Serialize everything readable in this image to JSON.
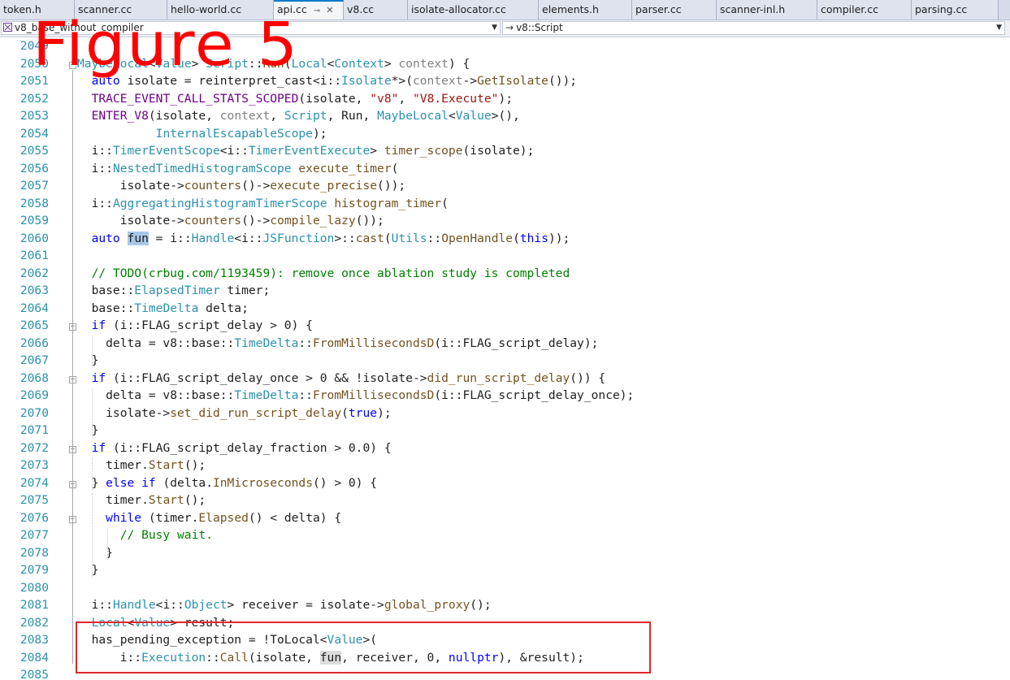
{
  "tabs": [
    {
      "label": "token.h",
      "active": false,
      "pinned": false
    },
    {
      "label": "scanner.cc",
      "active": false,
      "pinned": false
    },
    {
      "label": "hello-world.cc",
      "active": false,
      "pinned": false
    },
    {
      "label": "api.cc",
      "active": true,
      "pinned": true
    },
    {
      "label": "v8.cc",
      "active": false,
      "pinned": false
    },
    {
      "label": "isolate-allocator.cc",
      "active": false,
      "pinned": false
    },
    {
      "label": "elements.h",
      "active": false,
      "pinned": false
    },
    {
      "label": "parser.cc",
      "active": false,
      "pinned": false
    },
    {
      "label": "scanner-inl.h",
      "active": false,
      "pinned": false
    },
    {
      "label": "compiler.cc",
      "active": false,
      "pinned": false
    },
    {
      "label": "parsing.cc",
      "active": false,
      "pinned": false
    }
  ],
  "nav": {
    "project": "v8_base_without_compiler",
    "scope": "v8::Script"
  },
  "overlay": {
    "figure_label": "Figure 5",
    "highlight_color": "#e0262b"
  },
  "colors": {
    "keyword": "#0000ff",
    "type": "#2b91af",
    "function": "#74531f",
    "string": "#a31515",
    "macro": "#6f008a",
    "comment": "#008000",
    "line_number": "#2b91af",
    "accent": "#007acc"
  },
  "editor": {
    "lines": [
      {
        "n": "2049",
        "code": ""
      },
      {
        "n": "2050",
        "code": "MaybeLocal<Value> Script::Run(Local<Context> context) {"
      },
      {
        "n": "2051",
        "code": "  auto isolate = reinterpret_cast<i::Isolate*>(context->GetIsolate());"
      },
      {
        "n": "2052",
        "code": "  TRACE_EVENT_CALL_STATS_SCOPED(isolate, \"v8\", \"V8.Execute\");"
      },
      {
        "n": "2053",
        "code": "  ENTER_V8(isolate, context, Script, Run, MaybeLocal<Value>(),"
      },
      {
        "n": "2054",
        "code": "           InternalEscapableScope);"
      },
      {
        "n": "2055",
        "code": "  i::TimerEventScope<i::TimerEventExecute> timer_scope(isolate);"
      },
      {
        "n": "2056",
        "code": "  i::NestedTimedHistogramScope execute_timer("
      },
      {
        "n": "2057",
        "code": "      isolate->counters()->execute_precise());"
      },
      {
        "n": "2058",
        "code": "  i::AggregatingHistogramTimerScope histogram_timer("
      },
      {
        "n": "2059",
        "code": "      isolate->counters()->compile_lazy());"
      },
      {
        "n": "2060",
        "code": "  auto fun = i::Handle<i::JSFunction>::cast(Utils::OpenHandle(this));"
      },
      {
        "n": "2061",
        "code": ""
      },
      {
        "n": "2062",
        "code": "  // TODO(crbug.com/1193459): remove once ablation study is completed"
      },
      {
        "n": "2063",
        "code": "  base::ElapsedTimer timer;"
      },
      {
        "n": "2064",
        "code": "  base::TimeDelta delta;"
      },
      {
        "n": "2065",
        "code": "  if (i::FLAG_script_delay > 0) {"
      },
      {
        "n": "2066",
        "code": "    delta = v8::base::TimeDelta::FromMillisecondsD(i::FLAG_script_delay);"
      },
      {
        "n": "2067",
        "code": "  }"
      },
      {
        "n": "2068",
        "code": "  if (i::FLAG_script_delay_once > 0 && !isolate->did_run_script_delay()) {"
      },
      {
        "n": "2069",
        "code": "    delta = v8::base::TimeDelta::FromMillisecondsD(i::FLAG_script_delay_once);"
      },
      {
        "n": "2070",
        "code": "    isolate->set_did_run_script_delay(true);"
      },
      {
        "n": "2071",
        "code": "  }"
      },
      {
        "n": "2072",
        "code": "  if (i::FLAG_script_delay_fraction > 0.0) {"
      },
      {
        "n": "2073",
        "code": "    timer.Start();"
      },
      {
        "n": "2074",
        "code": "  } else if (delta.InMicroseconds() > 0) {"
      },
      {
        "n": "2075",
        "code": "    timer.Start();"
      },
      {
        "n": "2076",
        "code": "    while (timer.Elapsed() < delta) {"
      },
      {
        "n": "2077",
        "code": "      // Busy wait."
      },
      {
        "n": "2078",
        "code": "    }"
      },
      {
        "n": "2079",
        "code": "  }"
      },
      {
        "n": "2080",
        "code": ""
      },
      {
        "n": "2081",
        "code": "  i::Handle<i::Object> receiver = isolate->global_proxy();"
      },
      {
        "n": "2082",
        "code": "  Local<Value> result;"
      },
      {
        "n": "2083",
        "code": "  has_pending_exception = !ToLocal<Value>("
      },
      {
        "n": "2084",
        "code": "      i::Execution::Call(isolate, fun, receiver, 0, nullptr), &result);"
      },
      {
        "n": "2085",
        "code": ""
      }
    ]
  }
}
